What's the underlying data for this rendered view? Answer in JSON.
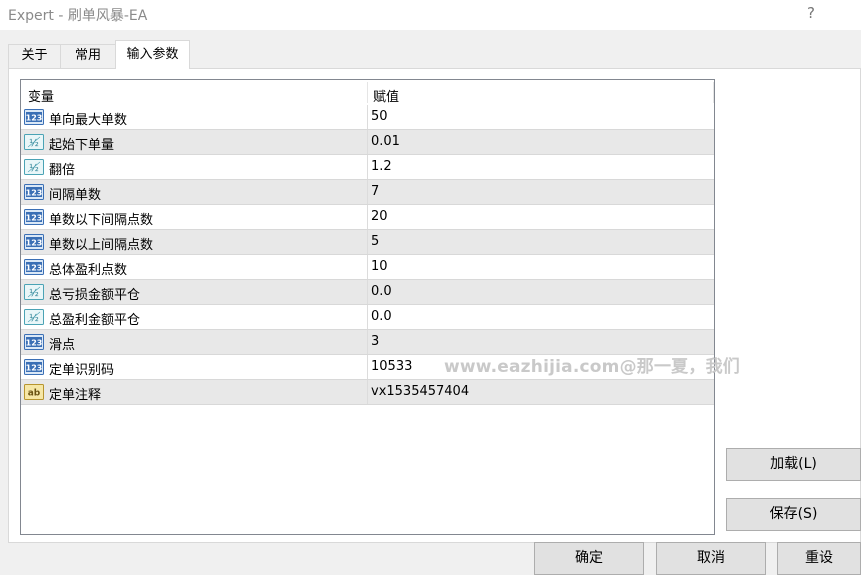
{
  "window": {
    "title": "Expert - 刷单风暴-EA",
    "help": "?"
  },
  "tabs": [
    {
      "label": "关于"
    },
    {
      "label": "常用"
    },
    {
      "label": "输入参数",
      "active": true
    }
  ],
  "grid": {
    "headers": {
      "variable": "变量",
      "value": "赋值"
    },
    "rows": [
      {
        "name": "单向最大单数",
        "value": "50",
        "type": "int-icon"
      },
      {
        "name": "起始下单量",
        "value": "0.01",
        "type": "double-icon"
      },
      {
        "name": "翻倍",
        "value": "1.2",
        "type": "double-icon"
      },
      {
        "name": "间隔单数",
        "value": "7",
        "type": "int-icon"
      },
      {
        "name": "单数以下间隔点数",
        "value": "20",
        "type": "int-icon"
      },
      {
        "name": "单数以上间隔点数",
        "value": "5",
        "type": "int-icon"
      },
      {
        "name": "总体盈利点数",
        "value": "10",
        "type": "int-icon"
      },
      {
        "name": "总亏损金额平仓",
        "value": "0.0",
        "type": "double-icon"
      },
      {
        "name": "总盈利金额平仓",
        "value": "0.0",
        "type": "double-icon"
      },
      {
        "name": "滑点",
        "value": "3",
        "type": "int-icon"
      },
      {
        "name": "定单识别码",
        "value": "10533",
        "type": "int-icon"
      },
      {
        "name": "定单注释",
        "value": "vx1535457404",
        "type": "string-icon"
      }
    ]
  },
  "buttons": {
    "load": "加载(L)",
    "save": "保存(S)",
    "ok": "确定",
    "cancel": "取消",
    "reset": "重设"
  },
  "watermark": "www.eazhijia.com@那一夏，我们"
}
